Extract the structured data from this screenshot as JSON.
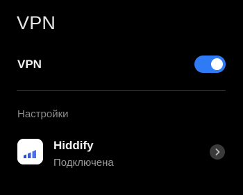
{
  "header": {
    "title": "VPN"
  },
  "vpn_toggle": {
    "label": "VPN",
    "state": "on",
    "accent_color": "#2f7bf6"
  },
  "settings": {
    "section_title": "Настройки",
    "profiles": [
      {
        "name": "Hiddify",
        "status": "Подключена",
        "icon": "hiddify-app-icon",
        "action_icon": "chevron-right-icon"
      }
    ]
  }
}
